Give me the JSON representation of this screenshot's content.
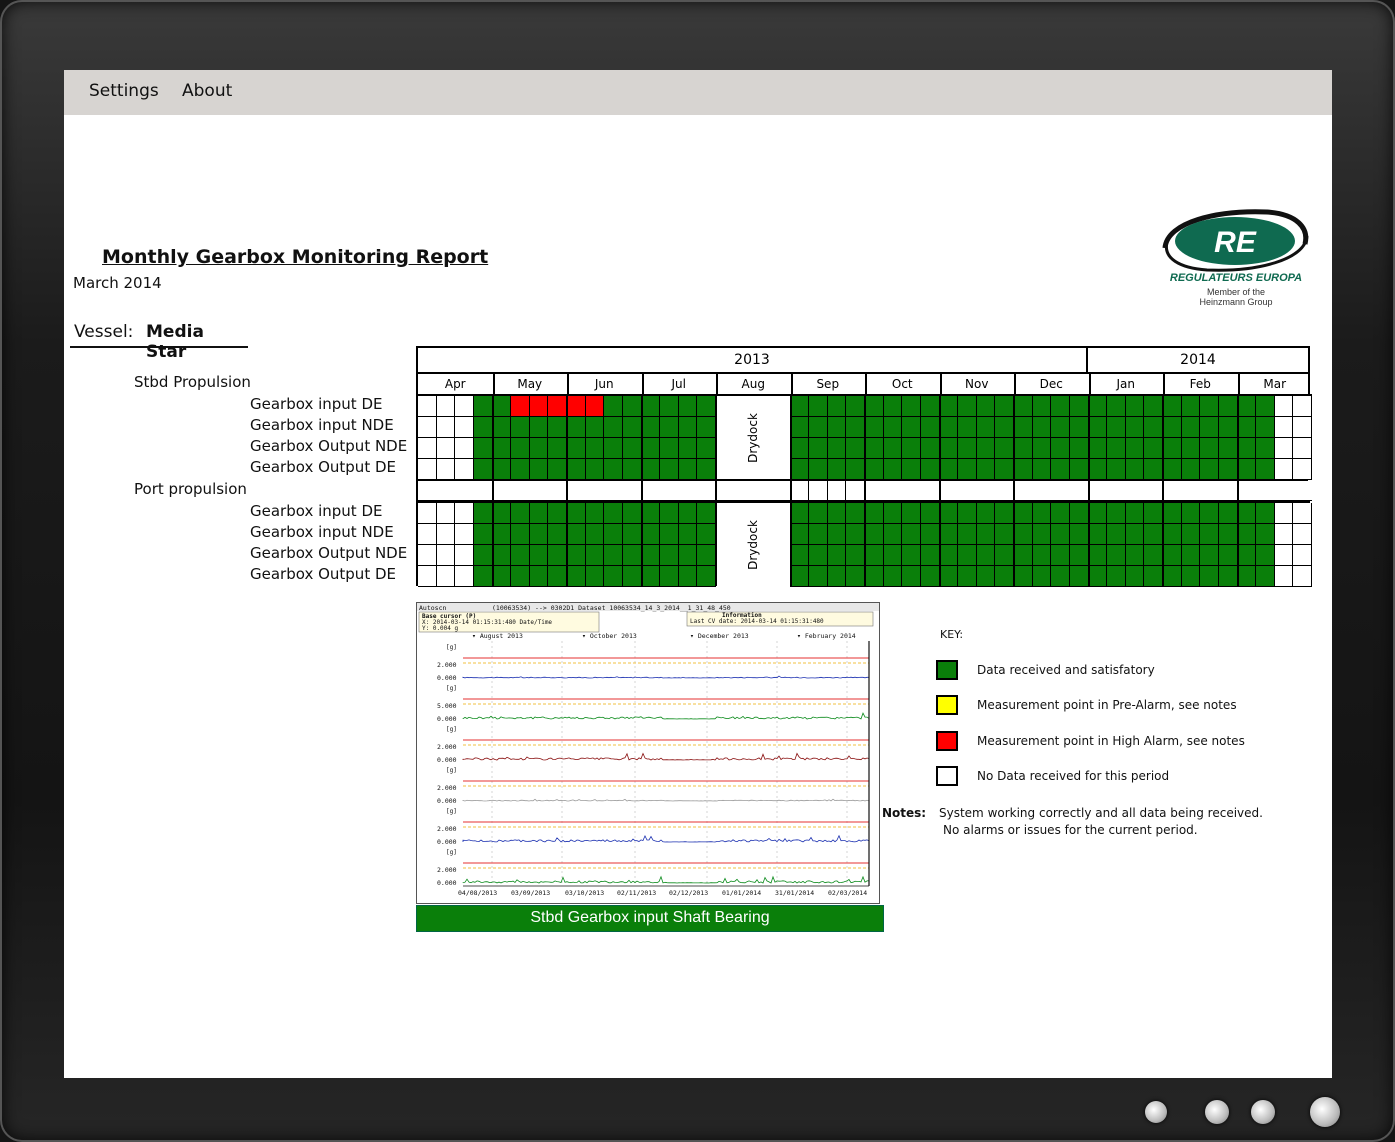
{
  "menu": {
    "settings": "Settings",
    "about": "About"
  },
  "report": {
    "title": "Monthly Gearbox Monitoring Report",
    "date": "March 2014",
    "vessel_label": "Vessel:",
    "vessel_name": "Media Star"
  },
  "logo": {
    "letters": "RE",
    "company": "REGULATEURS EUROPA",
    "member_line1": "Member of the",
    "member_line2": "Heinzmann Group"
  },
  "sections": [
    {
      "label": "Stbd Propulsion",
      "rows": [
        "Gearbox input DE",
        "Gearbox input NDE",
        "Gearbox Output NDE",
        "Gearbox Output DE"
      ]
    },
    {
      "label": "Port propulsion",
      "rows": [
        "Gearbox input DE",
        "Gearbox input NDE",
        "Gearbox Output NDE",
        "Gearbox Output DE"
      ]
    }
  ],
  "timeline": {
    "years": [
      "2013",
      "2014"
    ],
    "months": [
      "Apr",
      "May",
      "Jun",
      "Jul",
      "Aug",
      "Sep",
      "Oct",
      "Nov",
      "Dec",
      "Jan",
      "Feb",
      "Mar"
    ],
    "drydock_label": "Drydock",
    "status_legend": {
      "ok": "Data received and satisfactory",
      "high_alarm": "Measurement point in High Alarm, see notes",
      "no_data": "No Data received for this period"
    },
    "stbd_first_row_high_alarm_weeks": "May week 1 – Jun week 2",
    "leading_no_data_weeks": 3,
    "trailing_no_data_weeks": 2
  },
  "chart": {
    "header_left": "Autoscn",
    "header_mid": "(10063534) --> 0302D1 Dataset 10063534_14_3_2014__1_31_48_450",
    "cursor_title": "Base cursor (P)",
    "cursor_x": "X: 2014-03-14 01:15:31:480 Date/Time",
    "cursor_y": "Y: 0.004 g",
    "info_title": "Information",
    "info_line": "Last CV date: 2014-03-14 01:15:31:480",
    "top_markers": [
      "August 2013",
      "October 2013",
      "December 2013",
      "February 2014"
    ],
    "x_ticks": [
      "04/08/2013",
      "03/09/2013",
      "03/10/2013",
      "02/11/2013",
      "02/12/2013",
      "01/01/2014",
      "31/01/2014",
      "02/03/2014"
    ],
    "unit": "[g]",
    "panels": [
      {
        "ticks": [
          "2.000",
          "0.000"
        ],
        "color": "#1a2fb0"
      },
      {
        "ticks": [
          "5.000",
          "0.000"
        ],
        "color": "#0a8a1a"
      },
      {
        "ticks": [
          "2.000",
          "0.000"
        ],
        "color": "#8a1010"
      },
      {
        "ticks": [
          "2.000",
          "0.000"
        ],
        "color": "#9a9a9a"
      },
      {
        "ticks": [
          "2.000",
          "0.000"
        ],
        "color": "#1a2fb0"
      },
      {
        "ticks": [
          "2.000",
          "0.000"
        ],
        "color": "#0a8a1a"
      }
    ],
    "caption": "Stbd Gearbox input Shaft Bearing"
  },
  "key": {
    "title": "KEY:",
    "items": [
      {
        "color": "#0a7f0a",
        "text": "Data received and satisfatory"
      },
      {
        "color": "#ffff00",
        "text": "Measurement point in Pre-Alarm, see notes"
      },
      {
        "color": "#ff0000",
        "text": "Measurement point in High Alarm, see notes"
      },
      {
        "color": "#ffffff",
        "text": "No Data received for this period"
      }
    ]
  },
  "notes": {
    "label": "Notes:",
    "line1": "System working correctly and all data being received.",
    "line2": "No alarms or issues for the current period."
  },
  "colors": {
    "ok": "#0a7f0a",
    "alarm": "#ff0000",
    "nodata": "#ffffff",
    "menubar": "#d7d4d1"
  }
}
